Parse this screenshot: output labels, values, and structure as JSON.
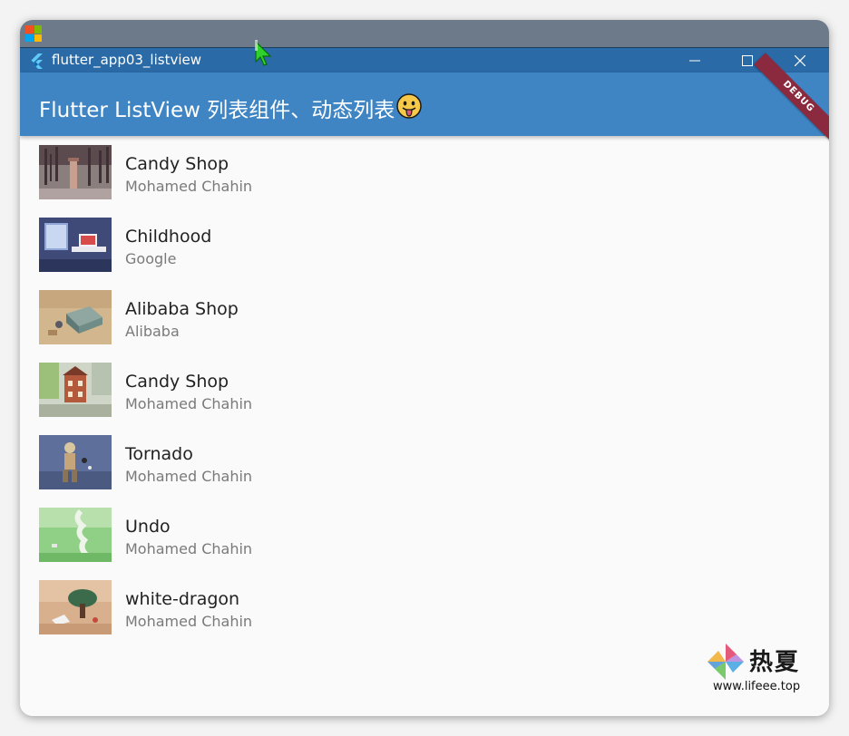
{
  "window": {
    "title": "flutter_app03_listview"
  },
  "appbar": {
    "title": "Flutter ListView 列表组件、动态列表",
    "emoji": "😛",
    "debug_banner": "DEBUG"
  },
  "colors": {
    "titlebar": "#2a6aa6",
    "appbar": "#3f84c3",
    "debug_banner": "#8b2a3e",
    "list_background": "#fafafa"
  },
  "list": {
    "items": [
      {
        "title": "Candy Shop",
        "author": "Mohamed Chahin",
        "thumbnail": "forest-tower-artwork"
      },
      {
        "title": "Childhood",
        "author": "Google",
        "thumbnail": "room-desk-artwork"
      },
      {
        "title": "Alibaba Shop",
        "author": "Alibaba",
        "thumbnail": "desert-shop-artwork"
      },
      {
        "title": "Candy Shop",
        "author": "Mohamed Chahin",
        "thumbnail": "brick-house-artwork"
      },
      {
        "title": "Tornado",
        "author": "Mohamed Chahin",
        "thumbnail": "robot-figure-artwork"
      },
      {
        "title": "Undo",
        "author": "Mohamed Chahin",
        "thumbnail": "green-field-tornado-artwork"
      },
      {
        "title": "white-dragon",
        "author": "Mohamed Chahin",
        "thumbnail": "tree-dragon-artwork"
      }
    ]
  },
  "watermark": {
    "chinese": "热夏",
    "url": "www.lifeee.top"
  }
}
